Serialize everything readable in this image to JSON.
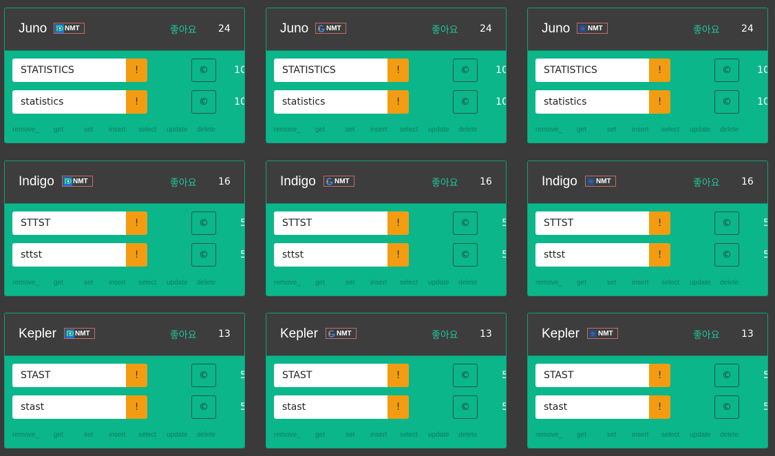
{
  "like_label": "좋아요",
  "nmt_label": "NMT",
  "warn_symbol": "!",
  "copy_symbol": "©",
  "actions": [
    "remove_",
    "get",
    "set",
    "insert",
    "select",
    "update",
    "delete"
  ],
  "providers": [
    "papago-logo",
    "google-logo",
    "other-logo"
  ],
  "colors": {
    "accent": "#0bb68a",
    "header": "#3d3d3d",
    "warn": "#f39c12",
    "bg": "#3a3a3a"
  },
  "groups": [
    {
      "name": "Juno",
      "likes": "24",
      "rows": [
        {
          "text": "STATISTICS",
          "count": "10"
        },
        {
          "text": "statistics",
          "count": "10"
        }
      ]
    },
    {
      "name": "Indigo",
      "likes": "16",
      "rows": [
        {
          "text": "STTST",
          "count": "5"
        },
        {
          "text": "sttst",
          "count": "5"
        }
      ]
    },
    {
      "name": "Kepler",
      "likes": "13",
      "rows": [
        {
          "text": "STAST",
          "count": "5"
        },
        {
          "text": "stast",
          "count": "5"
        }
      ]
    }
  ]
}
